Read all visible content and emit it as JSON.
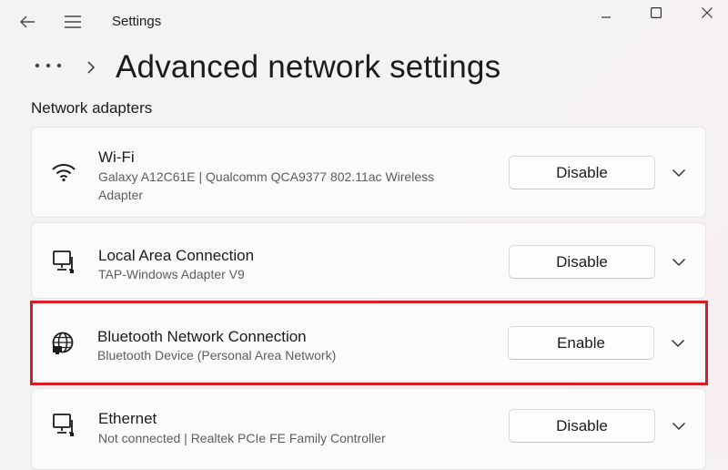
{
  "app": {
    "title": "Settings"
  },
  "breadcrumb": {
    "overflow": "•••",
    "separator": "›"
  },
  "page": {
    "title": "Advanced network settings"
  },
  "section": {
    "title": "Network adapters"
  },
  "adapters": [
    {
      "name": "Wi-Fi",
      "description": "Galaxy A12C61E | Qualcomm QCA9377 802.11ac Wireless Adapter",
      "action": "Disable",
      "icon": "wifi-icon"
    },
    {
      "name": "Local Area Connection",
      "description": "TAP-Windows Adapter V9",
      "action": "Disable",
      "icon": "wired-network-icon"
    },
    {
      "name": "Bluetooth Network Connection",
      "description": "Bluetooth Device (Personal Area Network)",
      "action": "Enable",
      "icon": "globe-network-icon",
      "highlighted": true
    },
    {
      "name": "Ethernet",
      "description": "Not connected | Realtek PCIe FE Family Controller",
      "action": "Disable",
      "icon": "wired-network-icon"
    }
  ],
  "colors": {
    "highlight": "#d51e26",
    "background": "#f3f3f3",
    "card": "#fbfbfb"
  }
}
